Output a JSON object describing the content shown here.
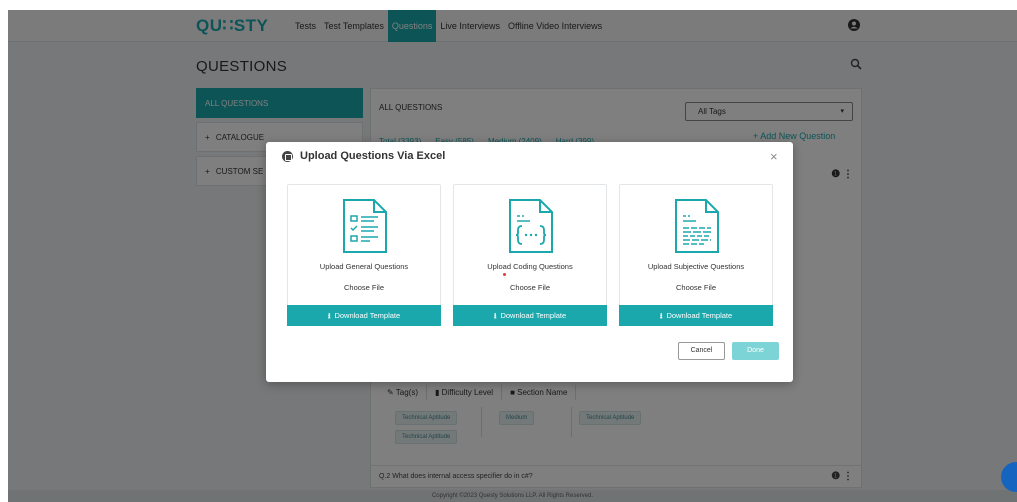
{
  "navbar": {
    "logo": "QU∷STY",
    "items": [
      {
        "label": "Tests"
      },
      {
        "label": "Test Templates"
      },
      {
        "label": "Questions"
      },
      {
        "label": "Live Interviews"
      },
      {
        "label": "Offline Video Interviews"
      }
    ],
    "active": "Questions",
    "user_icon": "user-circle-icon"
  },
  "page": {
    "title": "QUESTIONS",
    "search_icon": "search-icon"
  },
  "sidebar": {
    "items": [
      {
        "label": "ALL QUESTIONS"
      },
      {
        "label": "CATALOGUE",
        "prefix": "+"
      },
      {
        "label": "CUSTOM SE",
        "prefix": "+"
      }
    ]
  },
  "main": {
    "title": "ALL QUESTIONS",
    "tag_filter": {
      "selected": "All Tags"
    },
    "add_new": "+ Add New Question",
    "filters": [
      "Total (3393)",
      "Easy (585)",
      "Medium (2409)",
      "Hard (399)"
    ],
    "meta_headers": [
      "Tag(s)",
      "Difficulty Level",
      "Section Name"
    ],
    "tags": [
      "Technical Aptitude",
      "Technical Aptitude"
    ],
    "difficulty": "Medium",
    "section": "Technical Aptitude",
    "question2": "Q.2   What does internal access specifier do in c#?"
  },
  "footer": {
    "text": "Copyright ©2023 Questy Solutions LLP. All Rights Reserved."
  },
  "modal": {
    "title": "Upload Questions Via Excel",
    "close": "×",
    "cards": [
      {
        "label": "Upload General Questions",
        "choose": "Choose File",
        "download": "Download Template",
        "icon": "general-questions-doc-icon"
      },
      {
        "label": "Upload Coding Questions",
        "choose": "Choose File",
        "download": "Download Template",
        "icon": "coding-questions-doc-icon"
      },
      {
        "label": "Upload Subjective Questions",
        "choose": "Choose File",
        "download": "Download Template",
        "icon": "subjective-questions-doc-icon"
      }
    ],
    "cancel": "Cancel",
    "done": "Done"
  },
  "colors": {
    "accent": "#1aa8ad",
    "done_disabled": "#7dd4d6",
    "overlay": "rgba(0,0,0,0.5)"
  }
}
